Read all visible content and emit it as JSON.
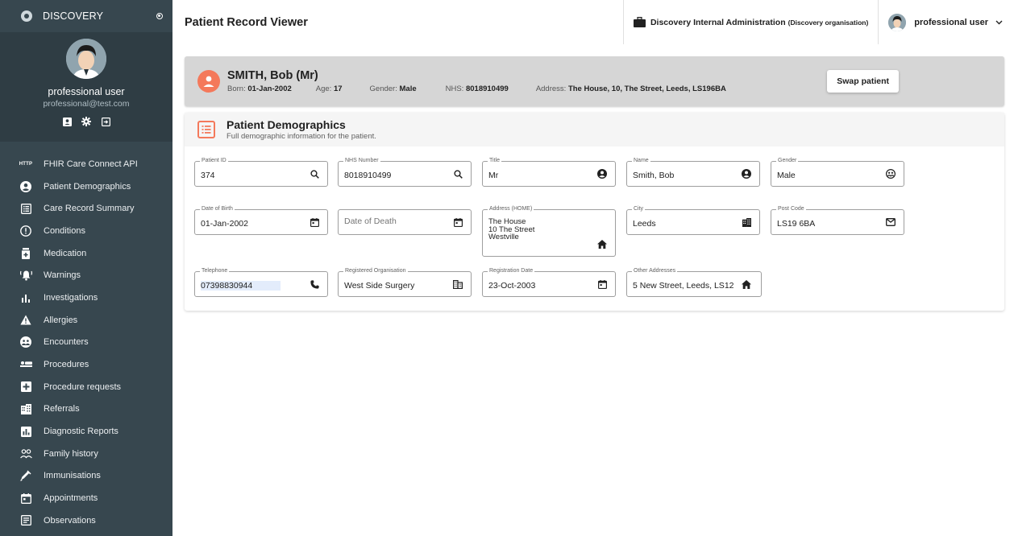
{
  "sidebar": {
    "brand": "DISCOVERY",
    "profile": {
      "name": "professional user",
      "email": "professional@test.com"
    },
    "items": [
      {
        "label": "FHIR Care Connect API",
        "icon": "http-icon"
      },
      {
        "label": "Patient Demographics",
        "icon": "account-circle-icon"
      },
      {
        "label": "Care Record Summary",
        "icon": "list-alt-icon"
      },
      {
        "label": "Conditions",
        "icon": "error-outline-icon"
      },
      {
        "label": "Medication",
        "icon": "medicine-bottle-icon"
      },
      {
        "label": "Warnings",
        "icon": "notification-alert-icon"
      },
      {
        "label": "Investigations",
        "icon": "bar-chart-icon"
      },
      {
        "label": "Allergies",
        "icon": "warning-triangle-icon"
      },
      {
        "label": "Encounters",
        "icon": "globe-people-icon"
      },
      {
        "label": "Procedures",
        "icon": "bed-icon"
      },
      {
        "label": "Procedure requests",
        "icon": "medical-plus-icon"
      },
      {
        "label": "Referrals",
        "icon": "building-icon"
      },
      {
        "label": "Diagnostic Reports",
        "icon": "report-chart-icon"
      },
      {
        "label": "Family history",
        "icon": "people-outline-icon"
      },
      {
        "label": "Immunisations",
        "icon": "syringe-icon"
      },
      {
        "label": "Appointments",
        "icon": "calendar-icon"
      },
      {
        "label": "Observations",
        "icon": "notes-icon"
      }
    ]
  },
  "topbar": {
    "title": "Patient Record Viewer",
    "org_name": "Discovery Internal Administration",
    "org_sub": "(Discovery organisation)",
    "user_name": "professional user"
  },
  "patient": {
    "name": "SMITH, Bob (Mr)",
    "born_label": "Born:",
    "born": "01-Jan-2002",
    "age_label": "Age:",
    "age": "17",
    "gender_label": "Gender:",
    "gender": "Male",
    "nhs_label": "NHS:",
    "nhs": "8018910499",
    "address_label": "Address:",
    "address": "The House, 10, The Street, Leeds, LS196BA",
    "swap_label": "Swap patient"
  },
  "demographics": {
    "title": "Patient Demographics",
    "subtitle": "Full demographic information for the patient.",
    "fields": {
      "patient_id": {
        "label": "Patient ID",
        "value": "374"
      },
      "nhs_number": {
        "label": "NHS Number",
        "value": "8018910499"
      },
      "title": {
        "label": "Title",
        "value": "Mr"
      },
      "name": {
        "label": "Name",
        "value": "Smith, Bob"
      },
      "gender": {
        "label": "Gender",
        "value": "Male"
      },
      "dob": {
        "label": "Date of Birth",
        "value": "01-Jan-2002"
      },
      "dod": {
        "placeholder": "Date of Death"
      },
      "address": {
        "label": "Address (HOME)",
        "value": "The House\n10 The Street\nWestville"
      },
      "city": {
        "label": "City",
        "value": "Leeds"
      },
      "postcode": {
        "label": "Post Code",
        "value": "LS19 6BA"
      },
      "telephone": {
        "label": "Telephone",
        "value": "07398830944"
      },
      "reg_org": {
        "label": "Registered Organisation",
        "value": "West Side Surgery"
      },
      "reg_date": {
        "label": "Registration Date",
        "value": "23-Oct-2003"
      },
      "other_addresses": {
        "label": "Other Addresses",
        "value": "5 New Street, Leeds, LS12"
      }
    }
  },
  "colors": {
    "sidebar": "#37474f",
    "accent": "#f4795b",
    "banner": "#d6d6d6"
  }
}
